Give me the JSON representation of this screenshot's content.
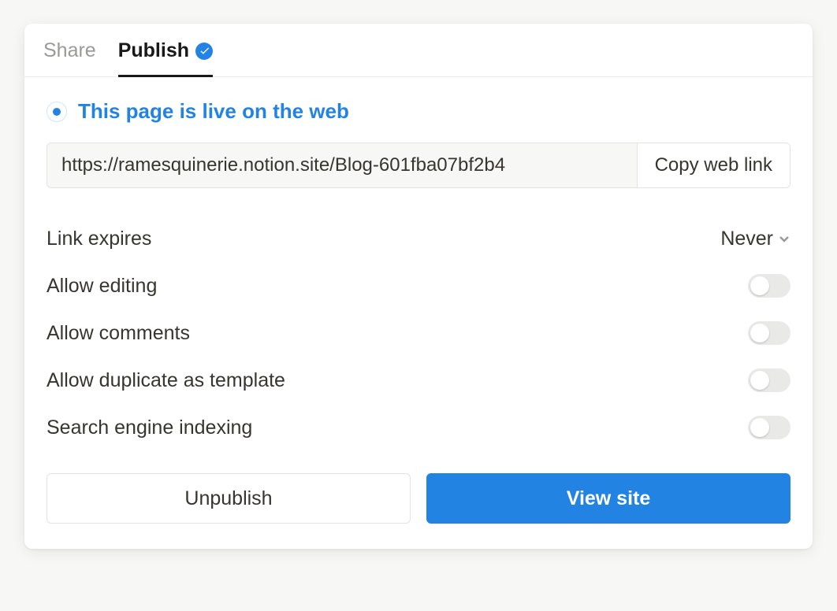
{
  "tabs": {
    "share": "Share",
    "publish": "Publish"
  },
  "live_status": "This page is live on the web",
  "url": "https://ramesquinerie.notion.site/Blog-601fba07bf2b4",
  "copy_button": "Copy web link",
  "settings": {
    "link_expires": {
      "label": "Link expires",
      "value": "Never"
    },
    "allow_editing": {
      "label": "Allow editing"
    },
    "allow_comments": {
      "label": "Allow comments"
    },
    "allow_duplicate": {
      "label": "Allow duplicate as template"
    },
    "search_indexing": {
      "label": "Search engine indexing"
    }
  },
  "buttons": {
    "unpublish": "Unpublish",
    "view_site": "View site"
  }
}
